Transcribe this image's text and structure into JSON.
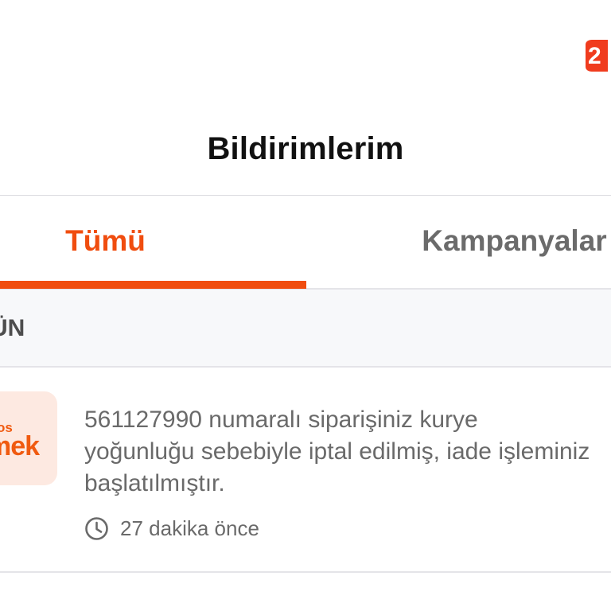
{
  "header": {
    "title": "Bildirimlerim"
  },
  "icons": {
    "corner": "notification-badge-icon",
    "clock": "clock-icon"
  },
  "tabs": [
    {
      "label": "Tümü",
      "active": true
    },
    {
      "label": "Kampanyalar",
      "active": false
    }
  ],
  "section": {
    "label": "ÜN"
  },
  "notification": {
    "logo_small": "os",
    "logo_big": "mek",
    "message": "561127990 numaralı siparişiniz kurye yoğunluğu sebebiyle iptal edilmiş, iade işleminiz başlatılmıştır.",
    "time": "27 dakika önce"
  },
  "colors": {
    "accent": "#f04d0f",
    "title": "#111111",
    "muted_text": "#6a6a6a",
    "section_bg": "#f7f8fa",
    "logo_bg": "#fde9e1"
  }
}
